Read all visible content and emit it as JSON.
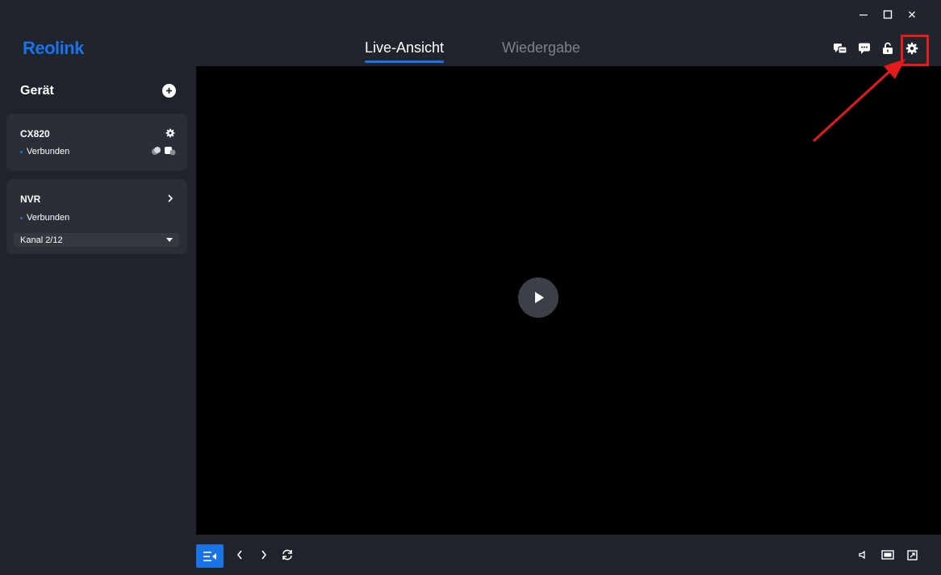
{
  "app": {
    "logo": "Reolink"
  },
  "window_controls": {
    "minimize_icon": "minimize-icon",
    "maximize_icon": "maximize-icon",
    "close_icon": "close-icon"
  },
  "header": {
    "tabs": [
      {
        "label": "Live-Ansicht",
        "active": true
      },
      {
        "label": "Wiedergabe",
        "active": false
      }
    ],
    "icons": [
      "message-center-icon",
      "chat-icon",
      "lock-icon",
      "settings-icon"
    ]
  },
  "sidebar": {
    "title": "Gerät",
    "devices": [
      {
        "name": "CX820",
        "status": "Verbunden",
        "action_icon": "gear-icon"
      },
      {
        "name": "NVR",
        "status": "Verbunden",
        "action_icon": "chevron-right-icon",
        "channel": "Kanal 2/12"
      }
    ]
  },
  "bottom_bar": {
    "left_icons": [
      "list-layout-icon",
      "chevron-left-icon",
      "chevron-right-icon",
      "refresh-icon"
    ],
    "right_icons": [
      "speaker-icon",
      "aspect-ratio-icon",
      "fullscreen-icon"
    ]
  },
  "colors": {
    "accent": "#1a73e8",
    "annotation": "#e31b1b",
    "background": "#1f232b",
    "video": "#000000"
  }
}
